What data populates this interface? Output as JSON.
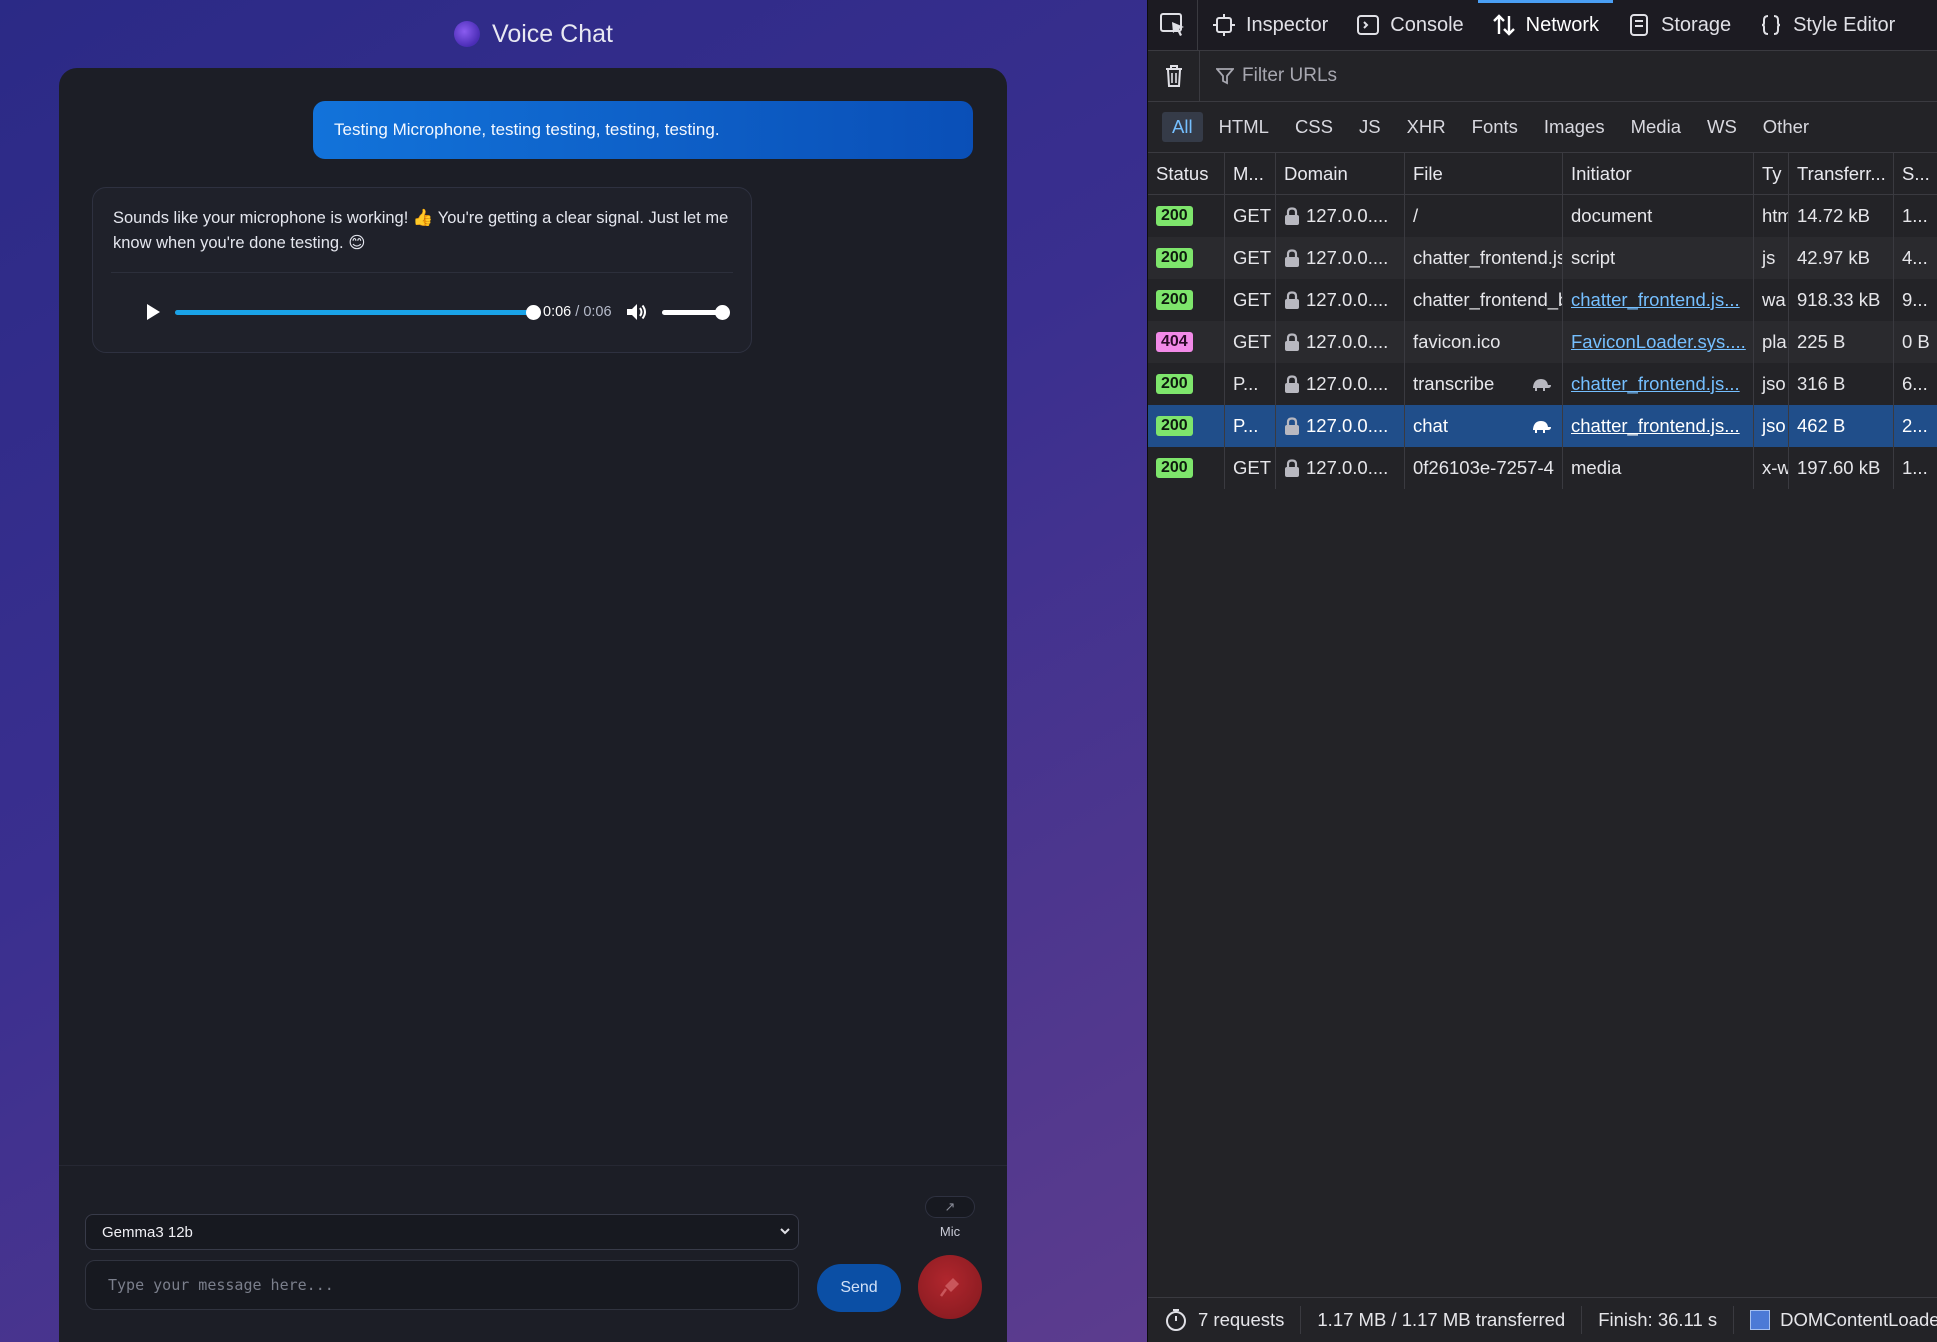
{
  "app": {
    "title": "Voice Chat",
    "messages": {
      "user": "Testing Microphone, testing testing, testing, testing.",
      "assistant": "Sounds like your microphone is working! 👍 You're getting a clear signal. Just let me know when you're done testing. 😊"
    },
    "audio": {
      "current_time": "0:06",
      "duration": "/ 0:06",
      "progress": 1.0,
      "volume": 1.0
    },
    "composer": {
      "model_selected": "Gemma3 12b",
      "input_placeholder": "Type your message here...",
      "send_label": "Send",
      "mic_label": "Mic",
      "expand_glyph": "↗"
    },
    "colors": {
      "user_bubble": "#0a4fb7",
      "mic_button": "#8d1c22",
      "send_button": "#0b4fa5"
    }
  },
  "devtools": {
    "tabs": [
      {
        "label": "Inspector",
        "icon": "inspector-icon"
      },
      {
        "label": "Console",
        "icon": "console-icon"
      },
      {
        "label": "Network",
        "icon": "network-icon",
        "active": true
      },
      {
        "label": "Storage",
        "icon": "storage-icon"
      },
      {
        "label": "Style Editor",
        "icon": "style-editor-icon"
      }
    ],
    "filter_placeholder": "Filter URLs",
    "type_filters": [
      "All",
      "HTML",
      "CSS",
      "JS",
      "XHR",
      "Fonts",
      "Images",
      "Media",
      "WS",
      "Other"
    ],
    "columns": [
      "Status",
      "M...",
      "Domain",
      "File",
      "Initiator",
      "Ty",
      "Transferr...",
      "S..."
    ],
    "requests": [
      {
        "status": "200",
        "method": "GET",
        "domain": "127.0.0....",
        "file": "/",
        "initiator": "document",
        "initiator_link": false,
        "type": "htm",
        "transferred": "14.72 kB",
        "size": "1..."
      },
      {
        "status": "200",
        "method": "GET",
        "domain": "127.0.0....",
        "file": "chatter_frontend.js",
        "initiator": "script",
        "initiator_link": false,
        "type": "js",
        "transferred": "42.97 kB",
        "size": "4..."
      },
      {
        "status": "200",
        "method": "GET",
        "domain": "127.0.0....",
        "file": "chatter_frontend_bg.wasm",
        "initiator": "chatter_frontend.js...",
        "initiator_link": true,
        "type": "wa",
        "transferred": "918.33 kB",
        "size": "9..."
      },
      {
        "status": "404",
        "method": "GET",
        "domain": "127.0.0....",
        "file": "favicon.ico",
        "initiator": "FaviconLoader.sys....",
        "initiator_link": true,
        "type": "pla",
        "transferred": "225 B",
        "size": "0 B"
      },
      {
        "status": "200",
        "method": "P...",
        "domain": "127.0.0....",
        "file": "transcribe",
        "initiator": "chatter_frontend.js...",
        "initiator_link": true,
        "type": "jso",
        "transferred": "316 B",
        "size": "6...",
        "slow": true
      },
      {
        "status": "200",
        "method": "P...",
        "domain": "127.0.0....",
        "file": "chat",
        "initiator": "chatter_frontend.js...",
        "initiator_link": true,
        "type": "jso",
        "transferred": "462 B",
        "size": "2...",
        "slow": true,
        "selected": true
      },
      {
        "status": "200",
        "method": "GET",
        "domain": "127.0.0....",
        "file": "0f26103e-7257-4",
        "initiator": "media",
        "initiator_link": false,
        "type": "x-w",
        "transferred": "197.60 kB",
        "size": "1..."
      }
    ],
    "status_bar": {
      "requests": "7 requests",
      "transferred": "1.17 MB / 1.17 MB transferred",
      "finish": "Finish: 36.11 s",
      "dcl": "DOMContentLoaded"
    }
  }
}
